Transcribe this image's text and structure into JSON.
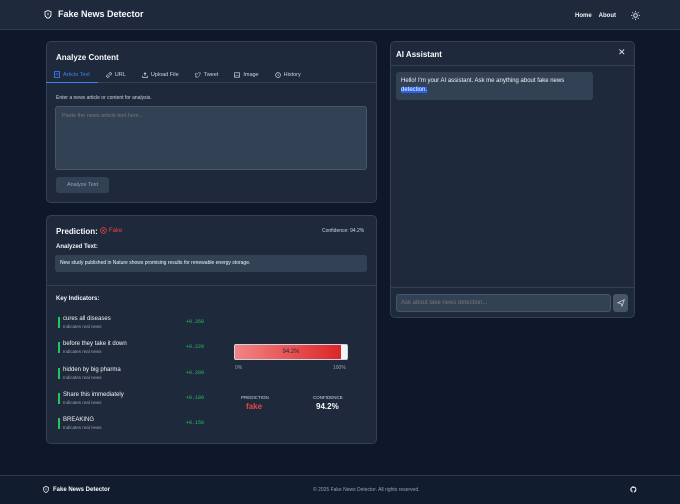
{
  "header": {
    "brand": "Fake News Detector",
    "nav": [
      "Home",
      "About"
    ]
  },
  "analyze": {
    "title": "Analyze Content",
    "tabs": [
      "Article Text",
      "URL",
      "Upload File",
      "Tweet",
      "Image",
      "History"
    ],
    "instruction": "Enter a news article or content for analysis.",
    "placeholder": "Paste the news article text here...",
    "button": "Analyze Text"
  },
  "prediction": {
    "label": "Prediction:",
    "badge": "Fake",
    "confidence_text": "Confidence: 94.2%",
    "analyzed_label": "Analyzed Text:",
    "analyzed_text": "New study published in Nature shows promising results for renewable energy storage.",
    "key_label": "Key Indicators:",
    "indicators": [
      {
        "word": "cures all diseases",
        "sub": "Indicates real news",
        "score": "+0.350"
      },
      {
        "word": "before they take it down",
        "sub": "Indicates real news",
        "score": "+0.220"
      },
      {
        "word": "hidden by big pharma",
        "sub": "Indicates real news",
        "score": "+0.200"
      },
      {
        "word": "Share this immediately",
        "sub": "Indicates real news",
        "score": "+0.180"
      },
      {
        "word": "BREAKING",
        "sub": "Indicates real news",
        "score": "+0.150"
      }
    ],
    "gauge": {
      "value_text": "94.2%",
      "fraction": 0.942,
      "min": "0%",
      "max": "100%"
    },
    "pred_caption": "PREDICTION",
    "pred_value": "fake",
    "conf_caption": "CONFIDENCE",
    "conf_value": "94.2%"
  },
  "assistant": {
    "title": "AI Assistant",
    "message_a": "Hello! I'm your AI assistant. Ask me anything about fake news ",
    "message_b": "detection.",
    "placeholder": "Ask about fake news detection..."
  },
  "footer": {
    "brand": "Fake News Detector",
    "copyright": "© 2025 Fake News Detector. All rights reserved."
  },
  "colors": {
    "accent": "#3b82f6",
    "fake": "#ef4444",
    "positive": "#22c55e"
  }
}
